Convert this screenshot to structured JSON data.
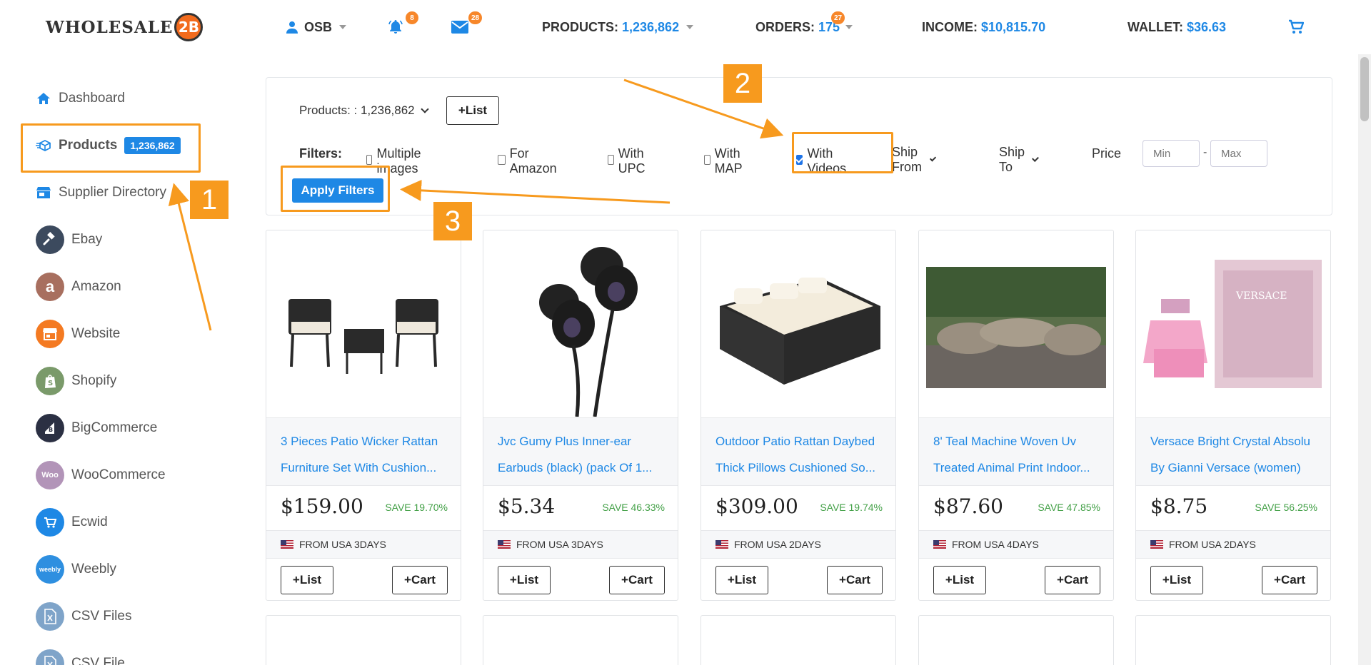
{
  "header": {
    "logo_text": "WHOLESALE",
    "logo_badge": "2B",
    "user": "OSB",
    "notifications_count": "8",
    "messages_count": "28",
    "products_label": "PRODUCTS:",
    "products_value": "1,236,862",
    "orders_label": "ORDERS:",
    "orders_value": "175",
    "orders_badge": "27",
    "income_label": "INCOME:",
    "income_value": "$10,815.70",
    "wallet_label": "WALLET:",
    "wallet_value": "$36.63"
  },
  "sidebar": {
    "items": [
      {
        "label": "Dashboard"
      },
      {
        "label": "Products",
        "count": "1,236,862"
      },
      {
        "label": "Supplier Directory"
      },
      {
        "label": "Ebay"
      },
      {
        "label": "Amazon"
      },
      {
        "label": "Website"
      },
      {
        "label": "Shopify"
      },
      {
        "label": "BigCommerce"
      },
      {
        "label": "WooCommerce"
      },
      {
        "label": "Ecwid"
      },
      {
        "label": "Weebly"
      },
      {
        "label": "CSV Files"
      },
      {
        "label": "CSV File"
      }
    ]
  },
  "filters": {
    "products_select": "Products: : 1,236,862",
    "list_button": "+List",
    "filters_label": "Filters:",
    "multiple_images": "Multiple images",
    "for_amazon": "For Amazon",
    "with_upc": "With UPC",
    "with_map": "With MAP",
    "with_videos": "With Videos",
    "with_videos_checked": true,
    "ship_from": "Ship From",
    "ship_to": "Ship To",
    "price_label": "Price",
    "price_min_placeholder": "Min",
    "price_separator": "-",
    "price_max_placeholder": "Max",
    "apply_button": "Apply Filters"
  },
  "annotations": {
    "step1": "1",
    "step2": "2",
    "step3": "3",
    "accent_color": "#f79a1e"
  },
  "products": [
    {
      "title1": "3 Pieces Patio Wicker Rattan",
      "title2": "Furniture Set With Cushion...",
      "price": "$159.00",
      "save": "SAVE 19.70%",
      "ship": "FROM USA 3DAYS"
    },
    {
      "title1": "Jvc Gumy Plus Inner-ear",
      "title2": "Earbuds (black) (pack Of 1...",
      "price": "$5.34",
      "save": "SAVE 46.33%",
      "ship": "FROM USA 3DAYS"
    },
    {
      "title1": "Outdoor Patio Rattan Daybed",
      "title2": "Thick Pillows Cushioned So...",
      "price": "$309.00",
      "save": "SAVE 19.74%",
      "ship": "FROM USA 2DAYS"
    },
    {
      "title1": "8' Teal Machine Woven Uv",
      "title2": "Treated Animal Print Indoor...",
      "price": "$87.60",
      "save": "SAVE 47.85%",
      "ship": "FROM USA 4DAYS"
    },
    {
      "title1": "Versace Bright Crystal Absolu",
      "title2": "By Gianni Versace (women)",
      "price": "$8.75",
      "save": "SAVE 56.25%",
      "ship": "FROM USA 2DAYS"
    }
  ],
  "card_buttons": {
    "list": "+List",
    "cart": "+Cart"
  }
}
